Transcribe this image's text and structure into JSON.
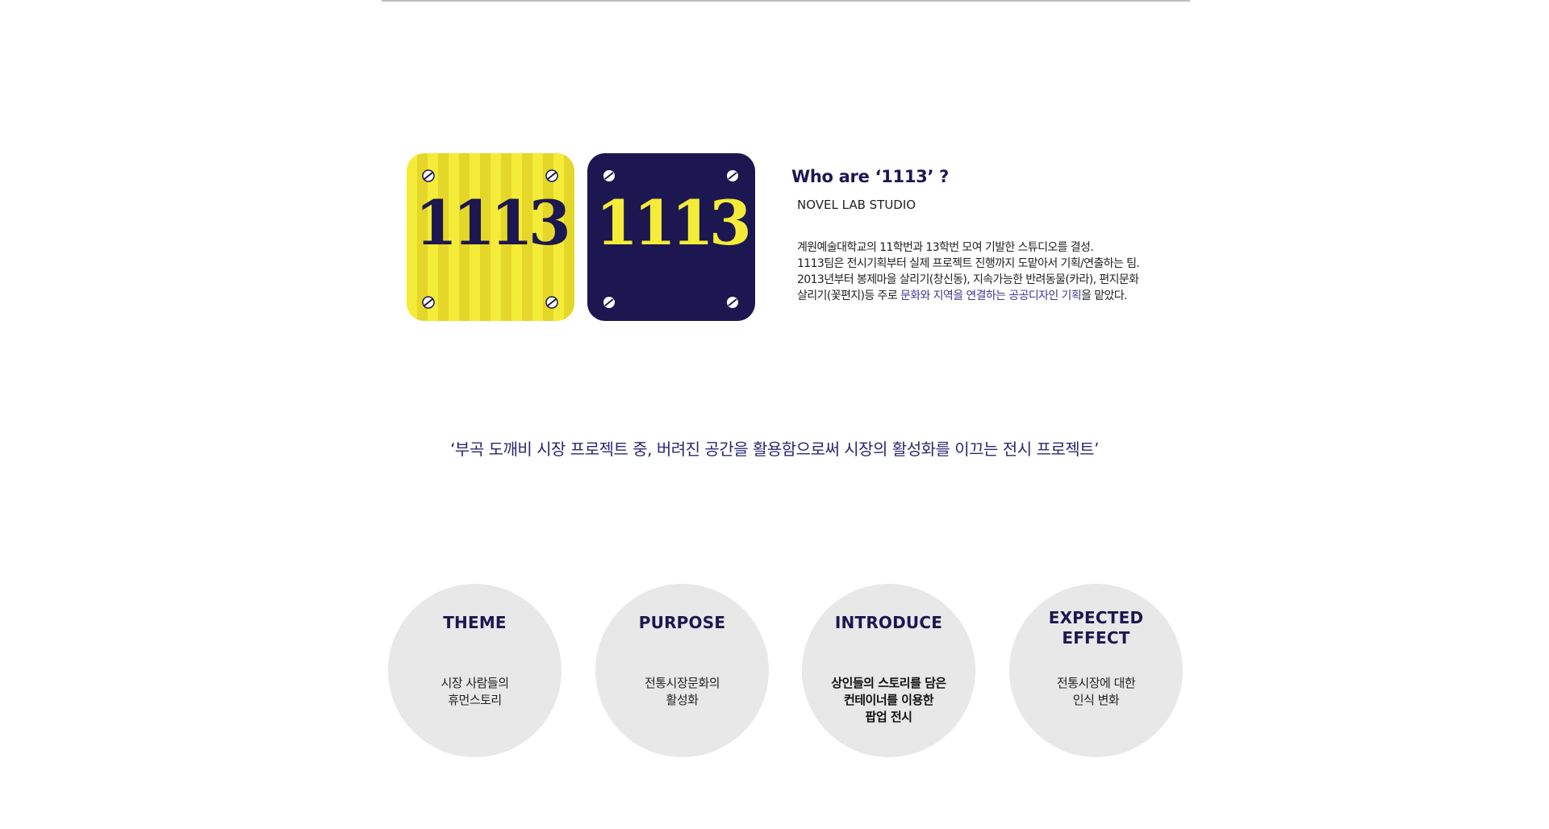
{
  "logos": {
    "yellow": {
      "text": "1113",
      "colors": {
        "background": "#f4ec38",
        "stripe": "#e4d72a",
        "ink": "#1c1750"
      }
    },
    "navy": {
      "text": "1113",
      "colors": {
        "background": "#1c1750",
        "ink": "#f4ec38"
      }
    }
  },
  "who": {
    "title": "Who are ‘1113’ ?",
    "subtitle": "NOVEL LAB STUDIO",
    "lines": [
      "계원예술대학교의 11학번과 13학번 모여 기발한 스튜디오를 결성.",
      "1113팀은 전시기획부터 실제 프로젝트 진행까지 도맡아서 기획/연출하는 팀.",
      "2013년부터 봉제마을 살리기(창신동), 지속가능한 반려동물(카라), 편지문화"
    ],
    "last_line": {
      "before": "살리기(꽃편지)등 주로 ",
      "highlight": "문화와 지역을 연결하는 공공디자인 기획",
      "after": "을 맡았다."
    }
  },
  "tagline": "‘부곡 도깨비 시장 프로젝트 중, 버려진 공간을 활용함으로써 시장의 활성화를 이끄는 전시 프로젝트’",
  "circles": [
    {
      "title": [
        "THEME"
      ],
      "desc": [
        "시장 사람들의",
        "휴먼스토리"
      ]
    },
    {
      "title": [
        "PURPOSE"
      ],
      "desc": [
        "전통시장문화의",
        "활성화"
      ]
    },
    {
      "title": [
        "INTRODUCE"
      ],
      "desc": [
        "상인들의 스토리를 담은",
        "컨테이너를 이용한",
        "팝업 전시"
      ]
    },
    {
      "title": [
        "EXPECTED",
        "EFFECT"
      ],
      "desc": [
        "전통시장에 대한",
        "인식 변화"
      ]
    }
  ],
  "colors": {
    "accent": "#1c1750",
    "highlight": "#3d3a8c",
    "circle": "#e8e8e8"
  }
}
